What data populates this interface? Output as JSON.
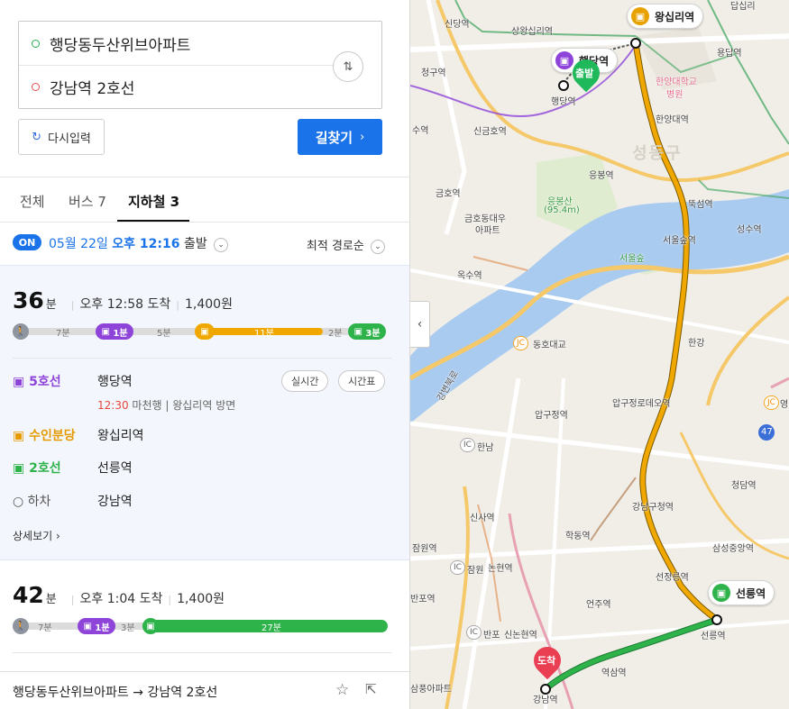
{
  "search": {
    "origin": "행당동두산위브아파트",
    "destination": "강남역 2호선",
    "reset_label": "다시입력",
    "search_label": "길찾기"
  },
  "tabs": [
    {
      "label": "전체"
    },
    {
      "label": "버스 7"
    },
    {
      "label": "지하철 3"
    }
  ],
  "depart": {
    "on": "ON",
    "date": "05월 22일",
    "time": "오후 12:16",
    "suffix": "출발",
    "sort": "최적 경로순"
  },
  "route1": {
    "minutes": "36",
    "unit": "분",
    "arrival": "오후 12:58 도착",
    "fare": "1,400원",
    "segments": {
      "walk1": "7분",
      "line5_pill": "1분",
      "walk2": "5분",
      "suin": "11분",
      "walk3": "2분",
      "line2_pill": "3분"
    },
    "steps": [
      {
        "line": "5호선",
        "station": "행당역",
        "sub_time": "12:30",
        "sub_text": "마천행 | 왕십리역 방면",
        "realtime": "실시간",
        "timetable": "시간표"
      },
      {
        "line": "수인분당",
        "station": "왕십리역"
      },
      {
        "line": "2호선",
        "station": "선릉역"
      },
      {
        "line": "하차",
        "station": "강남역"
      }
    ],
    "detail": "상세보기"
  },
  "route2": {
    "minutes": "42",
    "unit": "분",
    "arrival": "오후 1:04 도착",
    "fare": "1,400원",
    "segments": {
      "walk1": "7분",
      "line5_pill": "1분",
      "walk2": "3분",
      "line2": "27분"
    }
  },
  "bottom": {
    "summary_from": "행당동두산위브아파트",
    "summary_to": "강남역 2호선"
  },
  "map": {
    "callouts": {
      "wangsimni": "왕십리역",
      "haengdang": "행당역",
      "seolleung": "선릉역"
    },
    "pins": {
      "start": "출발",
      "end": "도착"
    },
    "labels": {
      "sindang": "신당역",
      "sangwangsimni": "상왕십리역",
      "cheonggu": "청구역",
      "hanyang_hosp": "한양대학교",
      "hosp": "병원",
      "hanyang_univ": "한양대역",
      "haengdang_small": "행당역",
      "yongdap": "용답역",
      "sindap": "답십리",
      "sindong": "신금호역",
      "gu": "수역",
      "seongdong": "성동구",
      "eungbong": "응봉역",
      "geumho": "금호역",
      "eungbongsan": "응봉산",
      "eungbongsan_h": "(95.4m)",
      "geumho_apt": "금호동대우",
      "geumho_apt2": "아파트",
      "ttukseom": "뚝섬역",
      "seongsu": "성수역",
      "seoulsup": "서울숲역",
      "seoulsup_park": "서울숲",
      "oksu": "옥수역",
      "hangang": "한강",
      "dongho": "동호대교",
      "apgujeong": "압구정역",
      "apgujeong_rodeo": "압구정로데오역",
      "hannam": "한남",
      "cheongdam": "청담역",
      "sinsa": "신사역",
      "gangnamgu": "강남구청역",
      "hakdong": "학동역",
      "samseongjungang": "삼성중앙역",
      "jamwon": "잠원역",
      "nonhyeon": "논현역",
      "jamwon_ic": "잠원",
      "seonjeongneung": "선정릉역",
      "banpo": "반포역",
      "eonju": "언주역",
      "sinnonhyeon": "신논현역",
      "banpo_ic": "반포",
      "seolleung_small": "선릉역",
      "yeoksam": "역삼역",
      "gangnam": "강남역",
      "samgpung": "삼풍아파트",
      "gangbyeon": "강변북로",
      "yeong": "영",
      "jc": "JC",
      "ic": "IC",
      "n47": "47"
    }
  }
}
